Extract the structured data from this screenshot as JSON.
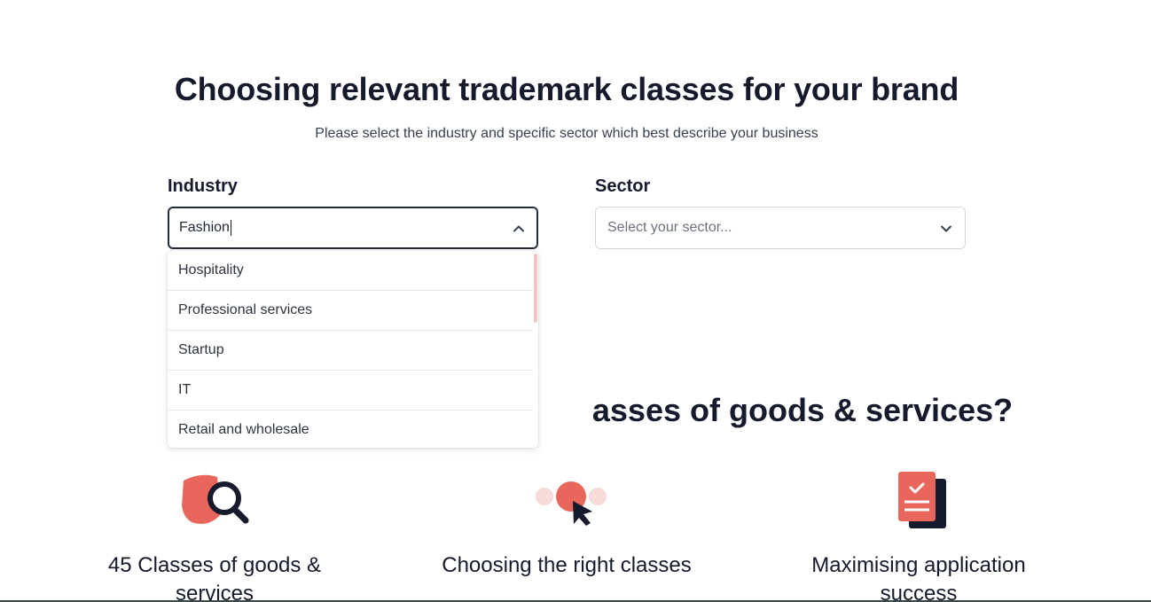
{
  "header": {
    "title": "Choosing relevant trademark classes for your brand",
    "subtitle": "Please select the industry and specific sector which best describe your business"
  },
  "industry": {
    "label": "Industry",
    "value": "Fashion",
    "options": [
      "Hospitality",
      "Professional services",
      "Startup",
      "IT",
      "Retail and wholesale"
    ]
  },
  "sector": {
    "label": "Sector",
    "placeholder": "Select your sector..."
  },
  "section": {
    "title_visible": "asses of goods & services?"
  },
  "features": [
    {
      "icon": "magnifier-icon",
      "text": "45 Classes of goods & services"
    },
    {
      "icon": "cursor-click-icon",
      "text": "Choosing the right classes"
    },
    {
      "icon": "document-check-icon",
      "text": "Maximising application success"
    }
  ],
  "colors": {
    "accent": "#e8665b",
    "dark": "#151a2c"
  }
}
